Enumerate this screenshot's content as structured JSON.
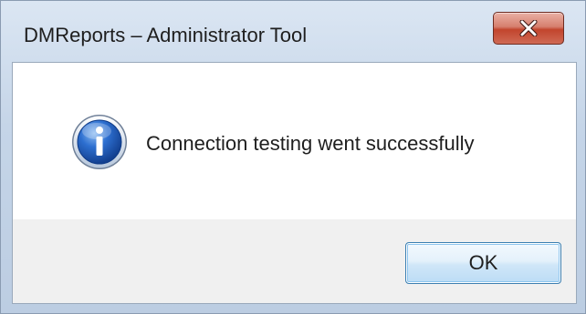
{
  "window": {
    "title": "DMReports – Administrator Tool",
    "close_icon": "close-x-icon",
    "close_color": "#c7452d"
  },
  "dialog": {
    "icon": "information-icon",
    "icon_color": "#1c5bb8",
    "message": "Connection testing went successfully",
    "ok_label": "OK"
  }
}
